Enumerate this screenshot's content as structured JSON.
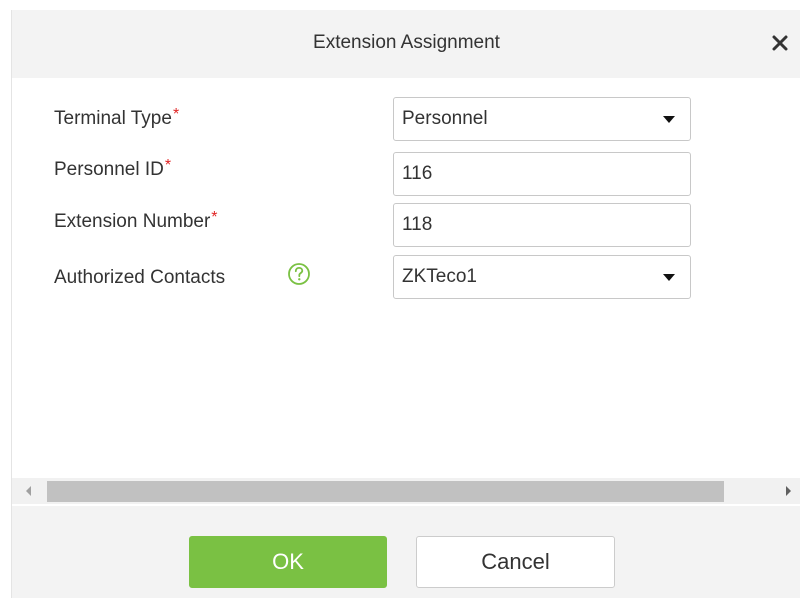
{
  "dialog": {
    "title": "Extension Assignment",
    "close_icon": "close-icon"
  },
  "form": {
    "terminal_type": {
      "label": "Terminal Type",
      "required_mark": "*",
      "value": "Personnel",
      "control": "select"
    },
    "personnel_id": {
      "label": "Personnel ID",
      "required_mark": "*",
      "value": "116",
      "control": "input"
    },
    "extension_number": {
      "label": "Extension Number",
      "required_mark": "*",
      "value": "118",
      "control": "input"
    },
    "authorized_contacts": {
      "label": "Authorized Contacts",
      "help_icon": "question-circle-icon",
      "value": "ZKTeco1",
      "control": "select"
    }
  },
  "footer": {
    "ok_label": "OK",
    "cancel_label": "Cancel"
  },
  "colors": {
    "required": "#e02424",
    "ok_button": "#7ac143",
    "help_icon": "#7ac143",
    "header_bg": "#f3f3f3"
  }
}
